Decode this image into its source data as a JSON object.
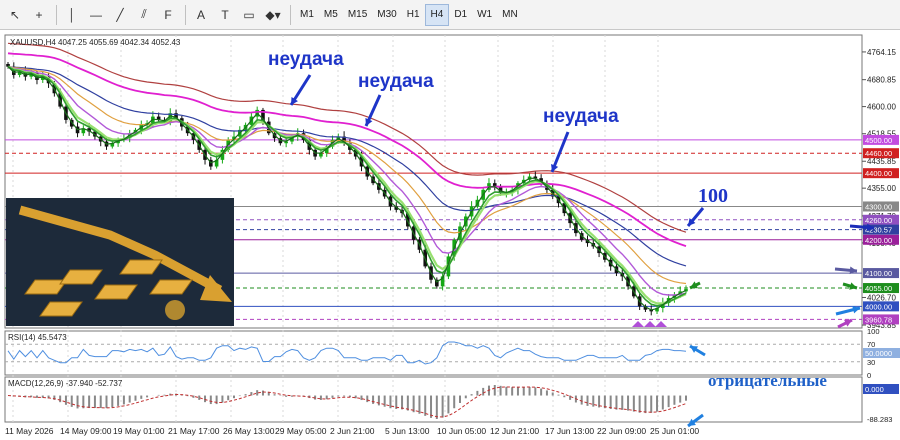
{
  "toolbar": {
    "tools": [
      {
        "name": "cursor-icon",
        "glyph": "↖"
      },
      {
        "name": "crosshair-icon",
        "glyph": "+"
      },
      {
        "name": "vertical-line-icon",
        "glyph": "│"
      },
      {
        "name": "horizontal-line-icon",
        "glyph": "—"
      },
      {
        "name": "trendline-icon",
        "glyph": "╱"
      },
      {
        "name": "channel-icon",
        "glyph": "⫽"
      },
      {
        "name": "fibonacci-icon",
        "glyph": "F"
      },
      {
        "name": "text-icon",
        "glyph": "A"
      },
      {
        "name": "label-icon",
        "glyph": "T"
      },
      {
        "name": "rectangle-icon",
        "glyph": "▭"
      },
      {
        "name": "shapes-icon",
        "glyph": "◆▾"
      }
    ],
    "timeframes": [
      "M1",
      "M5",
      "M15",
      "M30",
      "H1",
      "H4",
      "D1",
      "W1",
      "MN"
    ],
    "active_timeframe": "H4"
  },
  "colors": {
    "bull": "#15a815",
    "bear": "#111111",
    "ema_fast": "#1a6d1a",
    "ema_mid": "#2f9e2f",
    "ema_slow": "#98e070",
    "ma_purple": "#b25ad8",
    "ma_orange": "#e0a040",
    "ma_blue": "#3040a0",
    "ma_magenta": "#e020d0",
    "ma_brown": "#b04040",
    "annotation": "#1e35c8",
    "rsi": "#4f8fe0",
    "macd_line": "#c03030"
  },
  "chart_data": {
    "type": "candlestick",
    "title": "XAUUSD,H4  4047.25 4055.69 4042.34 4052.43",
    "symbol": "XAUUSD",
    "timeframe": "H4",
    "ohlc_last": {
      "open": 4047.25,
      "high": 4055.69,
      "low": 4042.34,
      "close": 4052.43
    },
    "price_axis": {
      "ticks": [
        4764.15,
        4680.85,
        4600.0,
        4518.55,
        4435.85,
        4355.0,
        4271.7,
        4190.4,
        4026.7,
        3943.85
      ],
      "ylim": [
        3935,
        4815
      ]
    },
    "x_ticks": [
      "11 May 2026",
      "14 May 09:00",
      "19 May 01:00",
      "21 May 17:00",
      "26 May 13:00",
      "29 May 05:00",
      "2 Jun 21:00",
      "5 Jun 13:00",
      "10 Jun 05:00",
      "12 Jun 21:00",
      "17 Jun 13:00",
      "22 Jun 09:00",
      "25 Jun 01:00"
    ],
    "levels": [
      {
        "price": 4500.0,
        "label": "4500.00",
        "color": "#c24ce0",
        "style": "solid"
      },
      {
        "price": 4460.0,
        "label": "4460.00",
        "color": "#d02020",
        "style": "dashed"
      },
      {
        "price": 4400.0,
        "label": "4400.00",
        "color": "#d02020",
        "style": "solid"
      },
      {
        "price": 4300.0,
        "label": "4300.00",
        "color": "#888888",
        "style": "solid"
      },
      {
        "price": 4260.0,
        "label": "4260.00",
        "color": "#9050c0",
        "style": "dashed"
      },
      {
        "price": 4230.57,
        "label": "4230.57",
        "color": "#3040a0",
        "style": "dashed"
      },
      {
        "price": 4200.0,
        "label": "4200.00",
        "color": "#9a1f9a",
        "style": "solid"
      },
      {
        "price": 4100.0,
        "label": "4100.00",
        "color": "#5a5aa0",
        "style": "solid"
      },
      {
        "price": 4055.0,
        "label": "4055.00",
        "color": "#1e8e1e",
        "style": "dashed"
      },
      {
        "price": 4000.0,
        "label": "4000.00",
        "color": "#3050c0",
        "style": "solid"
      },
      {
        "price": 3960.78,
        "label": "3960.78",
        "color": "#b040c0",
        "style": "dashed"
      }
    ],
    "close_path": [
      4720,
      4695,
      4705,
      4690,
      4700,
      4680,
      4690,
      4670,
      4640,
      4600,
      4560,
      4540,
      4520,
      4535,
      4525,
      4510,
      4495,
      4480,
      4490,
      4500,
      4505,
      4520,
      4530,
      4545,
      4550,
      4570,
      4560,
      4555,
      4580,
      4565,
      4540,
      4520,
      4500,
      4470,
      4440,
      4420,
      4440,
      4470,
      4500,
      4510,
      4530,
      4545,
      4570,
      4590,
      4555,
      4520,
      4505,
      4490,
      4495,
      4510,
      4520,
      4500,
      4470,
      4450,
      4460,
      4480,
      4500,
      4510,
      4490,
      4470,
      4450,
      4420,
      4390,
      4370,
      4350,
      4330,
      4300,
      4290,
      4280,
      4240,
      4200,
      4170,
      4120,
      4080,
      4060,
      4090,
      4150,
      4200,
      4240,
      4270,
      4300,
      4320,
      4350,
      4370,
      4360,
      4340,
      4340,
      4350,
      4370,
      4380,
      4390,
      4385,
      4370,
      4350,
      4330,
      4310,
      4280,
      4250,
      4220,
      4200,
      4190,
      4180,
      4160,
      4140,
      4120,
      4100,
      4090,
      4060,
      4030,
      4000,
      3990,
      3985,
      3995,
      4010,
      4025,
      4035,
      4045,
      4052
    ],
    "rsi": {
      "label": "RSI(14) 45.5473",
      "period": 14,
      "value": 45.5473,
      "levels": [
        30,
        70
      ],
      "ticks": [
        "100",
        "70",
        "50.0000",
        "30",
        "0"
      ]
    },
    "macd": {
      "label": "MACD(12,26,9) -37.940 -52.737",
      "params": [
        12,
        26,
        9
      ],
      "main": -37.94,
      "signal": -52.737,
      "ticks": [
        "0.000",
        "-88.283"
      ]
    },
    "annotations": [
      {
        "text": "неудача",
        "role": "failure-1"
      },
      {
        "text": "неудача",
        "role": "failure-2"
      },
      {
        "text": "неудача",
        "role": "failure-3"
      },
      {
        "text": "100",
        "role": "ma-label"
      },
      {
        "text": "отрицательные",
        "role": "macd-note"
      }
    ]
  }
}
